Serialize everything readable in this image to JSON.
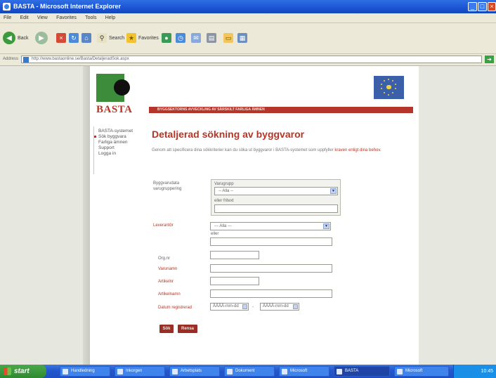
{
  "window": {
    "title": "BASTA - Microsoft Internet Explorer"
  },
  "menubar": [
    "File",
    "Edit",
    "View",
    "Favorites",
    "Tools",
    "Help"
  ],
  "toolbar": {
    "back": "Back",
    "search": "Search",
    "favorites": "Favorites"
  },
  "address": {
    "label": "Address",
    "url": "http://www.bastaonline.se/Basta/DetaljeradSok.aspx",
    "go": "Go"
  },
  "site": {
    "brand": "BASTA",
    "banner": "BYGGSEKTORNS AVVECKLING AV SÄRSKILT FARLIGA ÄMNEN"
  },
  "nav": [
    "BASTA-systemet",
    "Sök byggvara",
    "Farliga ämnen",
    "Support",
    "Logga in"
  ],
  "main": {
    "heading": "Detaljerad sökning av byggvaror",
    "intro": "Genom att specificera dina sökkriterier kan du söka ut byggvaror i BASTA-systemet som uppfyller",
    "intro_link": "kraven enligt dina behov."
  },
  "form": {
    "group_label": "Byggvarudata varugruppering",
    "group_sub": "Varugrupp",
    "group_select": "-- Alla --",
    "group_or": "eller fritext",
    "supplier_label": "Leverantör",
    "supplier_select": "--- Alla ---",
    "supplier_or": "eller",
    "orgnr_label": "Org.nr",
    "product_label": "Varunamn",
    "article_label": "Artikelnr",
    "identifier_label": "Artikelnamn",
    "date_label": "Datum registrerad",
    "date_from": "ÅÅÅÅ-mm-dd",
    "date_sep": "-",
    "date_to": "ÅÅÅÅ-mm-dd",
    "search_button": "Sök",
    "clear_button": "Rensa"
  },
  "taskbar": {
    "start": "start",
    "tasks": [
      "Handledning",
      "Inkorgen",
      "Arbetsplats",
      "Dokument",
      "Microsoft",
      "BASTA",
      "Microsoft"
    ],
    "active_index": 5,
    "clock": "10:45"
  }
}
